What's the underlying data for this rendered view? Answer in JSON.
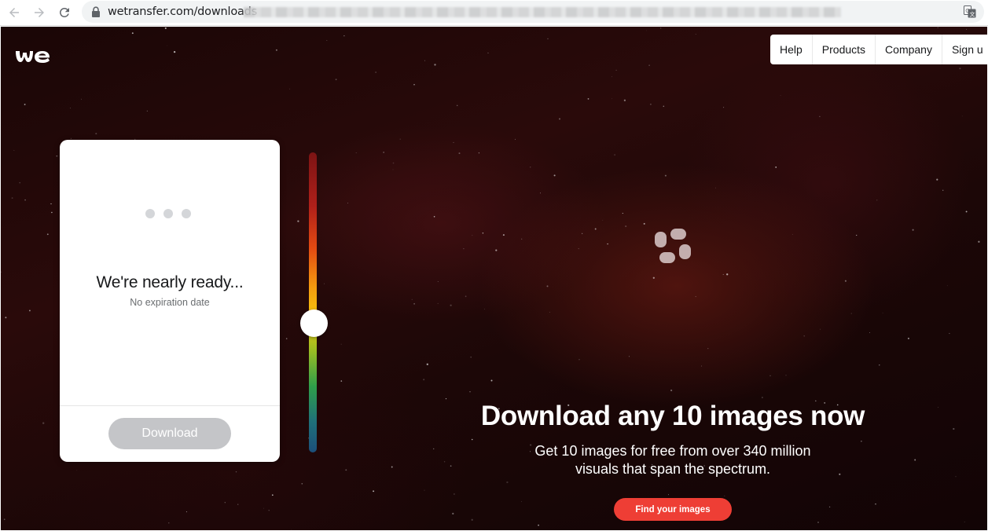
{
  "browser": {
    "url_text": "wetransfer.com/downloads",
    "nav_icons": [
      "back-arrow-icon",
      "forward-arrow-icon",
      "reload-icon"
    ],
    "lock_icon": "lock-icon",
    "translate_icon": "translate-icon"
  },
  "header": {
    "logo_icon": "wetransfer-logo",
    "nav": [
      {
        "label": "Help"
      },
      {
        "label": "Products"
      },
      {
        "label": "Company"
      },
      {
        "label": "Sign u"
      }
    ]
  },
  "card": {
    "title": "We're nearly ready...",
    "subtitle": "No expiration date",
    "download_label": "Download"
  },
  "slider": {
    "level": 0.57
  },
  "promo": {
    "title": "Download any 10 images now",
    "subtitle_line1": "Get 10 images for free from over 340 million",
    "subtitle_line2": "visuals that span the spectrum.",
    "cta_label": "Find your images"
  },
  "colors": {
    "cta": "#ee3e35",
    "download_disabled": "#c4c5c8",
    "background": "#1c0707"
  }
}
